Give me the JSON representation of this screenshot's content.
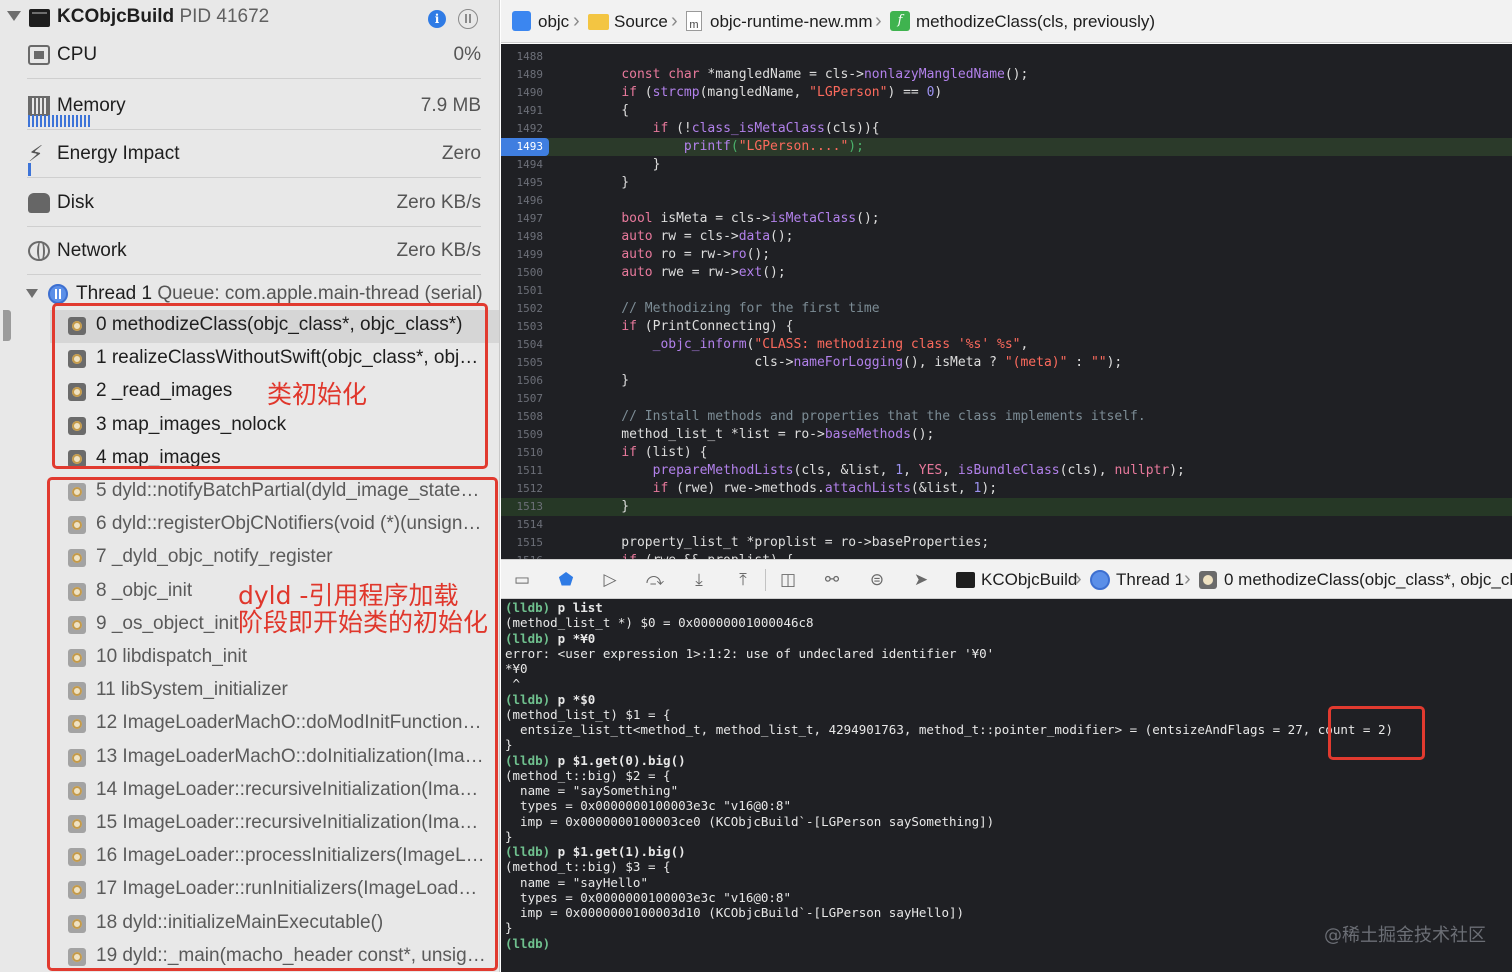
{
  "navigator": {
    "process": {
      "name": "KCObjcBuild",
      "pid": "PID 41672"
    },
    "gauges": [
      {
        "label": "CPU",
        "value": "0%"
      },
      {
        "label": "Memory",
        "value": "7.9 MB"
      },
      {
        "label": "Energy Impact",
        "value": "Zero"
      },
      {
        "label": "Disk",
        "value": "Zero KB/s"
      },
      {
        "label": "Network",
        "value": "Zero KB/s"
      }
    ],
    "thread": {
      "name": "Thread 1",
      "queue": "Queue: com.apple.main-thread (serial)"
    },
    "frames": [
      "0 methodizeClass(objc_class*, objc_class*)",
      "1 realizeClassWithoutSwift(objc_class*, objc…",
      "2 _read_images",
      "3 map_images_nolock",
      "4 map_images",
      "5 dyld::notifyBatchPartial(dyld_image_states…",
      "6 dyld::registerObjCNotifiers(void (*)(unsign…",
      "7 _dyld_objc_notify_register",
      "8 _objc_init",
      "9 _os_object_init",
      "10 libdispatch_init",
      "11 libSystem_initializer",
      "12 ImageLoaderMachO::doModInitFunctions…",
      "13 ImageLoaderMachO::doInitialization(Imag…",
      "14 ImageLoader::recursiveInitialization(Imag…",
      "15 ImageLoader::recursiveInitialization(Imag…",
      "16 ImageLoader::processInitializers(ImageLo…",
      "17 ImageLoader::runInitializers(ImageLoader…",
      "18 dyld::initializeMainExecutable()",
      "19 dyld::_main(macho_header const*, unsign…"
    ],
    "annotations": {
      "class_init": "类初始化",
      "dyld_line1": "dyld -引用程序加载",
      "dyld_line2": "阶段即开始类的初始化"
    },
    "accent_color": "#e13a2f"
  },
  "jumpbar": {
    "items": [
      "objc",
      "Source",
      "objc-runtime-new.mm",
      "methodizeClass(cls, previously)"
    ],
    "icons": [
      "project-icon",
      "folder-icon",
      "mm-file-icon",
      "function-icon"
    ]
  },
  "editor": {
    "current_line": "1493",
    "lines": [
      {
        "n": "1488",
        "code": ""
      },
      {
        "n": "1489",
        "code": "    const char *mangledName = cls->nonlazyMangledName();"
      },
      {
        "n": "1490",
        "code": "    if (strcmp(mangledName, \"LGPerson\") == 0)"
      },
      {
        "n": "1491",
        "code": "    {"
      },
      {
        "n": "1492",
        "code": "        if (!class_isMetaClass(cls)){"
      },
      {
        "n": "1493",
        "code": "            printf(\"LGPerson....\");"
      },
      {
        "n": "1494",
        "code": "        }"
      },
      {
        "n": "1495",
        "code": "    }"
      },
      {
        "n": "1496",
        "code": ""
      },
      {
        "n": "1497",
        "code": "    bool isMeta = cls->isMetaClass();"
      },
      {
        "n": "1498",
        "code": "    auto rw = cls->data();"
      },
      {
        "n": "1499",
        "code": "    auto ro = rw->ro();"
      },
      {
        "n": "1500",
        "code": "    auto rwe = rw->ext();"
      },
      {
        "n": "1501",
        "code": ""
      },
      {
        "n": "1502",
        "code": "    // Methodizing for the first time"
      },
      {
        "n": "1503",
        "code": "    if (PrintConnecting) {"
      },
      {
        "n": "1504",
        "code": "        _objc_inform(\"CLASS: methodizing class '%s' %s\","
      },
      {
        "n": "1505",
        "code": "                     cls->nameForLogging(), isMeta ? \"(meta)\" : \"\");"
      },
      {
        "n": "1506",
        "code": "    }"
      },
      {
        "n": "1507",
        "code": ""
      },
      {
        "n": "1508",
        "code": "    // Install methods and properties that the class implements itself."
      },
      {
        "n": "1509",
        "code": "    method_list_t *list = ro->baseMethods();"
      },
      {
        "n": "1510",
        "code": "    if (list) {"
      },
      {
        "n": "1511",
        "code": "        prepareMethodLists(cls, &list, 1, YES, isBundleClass(cls), nullptr);"
      },
      {
        "n": "1512",
        "code": "        if (rwe) rwe->methods.attachLists(&list, 1);"
      },
      {
        "n": "1513",
        "code": "    }"
      },
      {
        "n": "1514",
        "code": ""
      },
      {
        "n": "1515",
        "code": "    property_list_t *proplist = ro->baseProperties;"
      },
      {
        "n": "1516",
        "code": "    if (rwe && proplist) {"
      }
    ]
  },
  "debugbar": {
    "app": "KCObjcBuild",
    "thread": "Thread 1",
    "frame": "0 methodizeClass(objc_class*, objc_clas"
  },
  "console": {
    "lines": [
      {
        "prompt": "(lldb)",
        "text": " p list"
      },
      {
        "prompt": "",
        "text": "(method_list_t *) $0 = 0x00000001000046c8"
      },
      {
        "prompt": "(lldb)",
        "text": " p *¥0"
      },
      {
        "prompt": "",
        "text": "error: <user expression 1>:1:2: use of undeclared identifier '¥0'"
      },
      {
        "prompt": "",
        "text": "*¥0"
      },
      {
        "prompt": "",
        "text": " ^"
      },
      {
        "prompt": "(lldb)",
        "text": " p *$0"
      },
      {
        "prompt": "",
        "text": "(method_list_t) $1 = {"
      },
      {
        "prompt": "",
        "text": "  entsize_list_tt<method_t, method_list_t, 4294901763, method_t::pointer_modifier> = (entsizeAndFlags = 27, count = 2)"
      },
      {
        "prompt": "",
        "text": "}"
      },
      {
        "prompt": "(lldb)",
        "text": " p $1.get(0).big()"
      },
      {
        "prompt": "",
        "text": "(method_t::big) $2 = {"
      },
      {
        "prompt": "",
        "text": "  name = \"saySomething\""
      },
      {
        "prompt": "",
        "text": "  types = 0x0000000100003e3c \"v16@0:8\""
      },
      {
        "prompt": "",
        "text": "  imp = 0x0000000100003ce0 (KCObjcBuild`-[LGPerson saySomething])"
      },
      {
        "prompt": "",
        "text": "}"
      },
      {
        "prompt": "(lldb)",
        "text": " p $1.get(1).big()"
      },
      {
        "prompt": "",
        "text": "(method_t::big) $3 = {"
      },
      {
        "prompt": "",
        "text": "  name = \"sayHello\""
      },
      {
        "prompt": "",
        "text": "  types = 0x0000000100003e3c \"v16@0:8\""
      },
      {
        "prompt": "",
        "text": "  imp = 0x0000000100003d10 (KCObjcBuild`-[LGPerson sayHello])"
      },
      {
        "prompt": "",
        "text": "}"
      },
      {
        "prompt": "(lldb)",
        "text": ""
      }
    ],
    "watermark": "@稀土掘金技术社区"
  }
}
